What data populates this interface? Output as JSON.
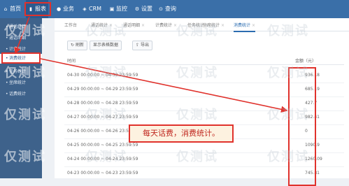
{
  "nav": {
    "items": [
      {
        "label": "首页",
        "icon": "home-icon",
        "glyph": "⌂"
      },
      {
        "label": "报表",
        "icon": "chart-icon",
        "glyph": "▮"
      },
      {
        "label": "业务",
        "icon": "user-icon",
        "glyph": "●"
      },
      {
        "label": "CRM",
        "icon": "crm-icon",
        "glyph": "◈"
      },
      {
        "label": "监控",
        "icon": "monitor-icon",
        "glyph": "▣"
      },
      {
        "label": "设置",
        "icon": "gear-icon",
        "glyph": "⚙"
      },
      {
        "label": "查询",
        "icon": "search-icon",
        "glyph": "⊙"
      }
    ]
  },
  "sidebar": {
    "items": [
      {
        "label": "通话统计"
      },
      {
        "label": "通话明细"
      },
      {
        "label": "计费统计"
      },
      {
        "label": "消费统计"
      },
      {
        "label": "任务统计"
      },
      {
        "label": "坐席统计"
      },
      {
        "label": "话费统计"
      }
    ]
  },
  "tabs": [
    {
      "label": "工作台"
    },
    {
      "label": "通话统计"
    },
    {
      "label": "通话明细"
    },
    {
      "label": "计费统计"
    },
    {
      "label": "任务统计"
    },
    {
      "label": "坐席统计"
    },
    {
      "label": "消费统计"
    }
  ],
  "toolbar": {
    "refresh": "刷新",
    "show_data": "显示表格数据",
    "export": "导出"
  },
  "table": {
    "col_time": "时间",
    "col_amount": "金额（元）",
    "rows": [
      {
        "time": "04-30 00:00:00 ~ 04-30 23:59:59",
        "amount": "936.18"
      },
      {
        "time": "04-29 00:00:00 ~ 04-29 23:59:59",
        "amount": "685.19"
      },
      {
        "time": "04-28 00:00:00 ~ 04-28 23:59:59",
        "amount": "427.7"
      },
      {
        "time": "04-27 00:00:00 ~ 04-27 23:59:59",
        "amount": "982.41"
      },
      {
        "time": "04-26 00:00:00 ~ 04-26 23:59:59",
        "amount": "0"
      },
      {
        "time": "04-25 00:00:00 ~ 04-25 23:59:59",
        "amount": "1090.9"
      },
      {
        "time": "04-24 00:00:00 ~ 04-24 23:59:59",
        "amount": "1260.09"
      },
      {
        "time": "04-23 00:00:00 ~ 04-23 23:59:59",
        "amount": "745.81"
      }
    ]
  },
  "annotation": "每天话费，消费统计。",
  "watermark": "仅测试",
  "colors": {
    "nav": "#3a6fa8",
    "sidebar": "#3e628b",
    "highlight": "#e0322c"
  }
}
